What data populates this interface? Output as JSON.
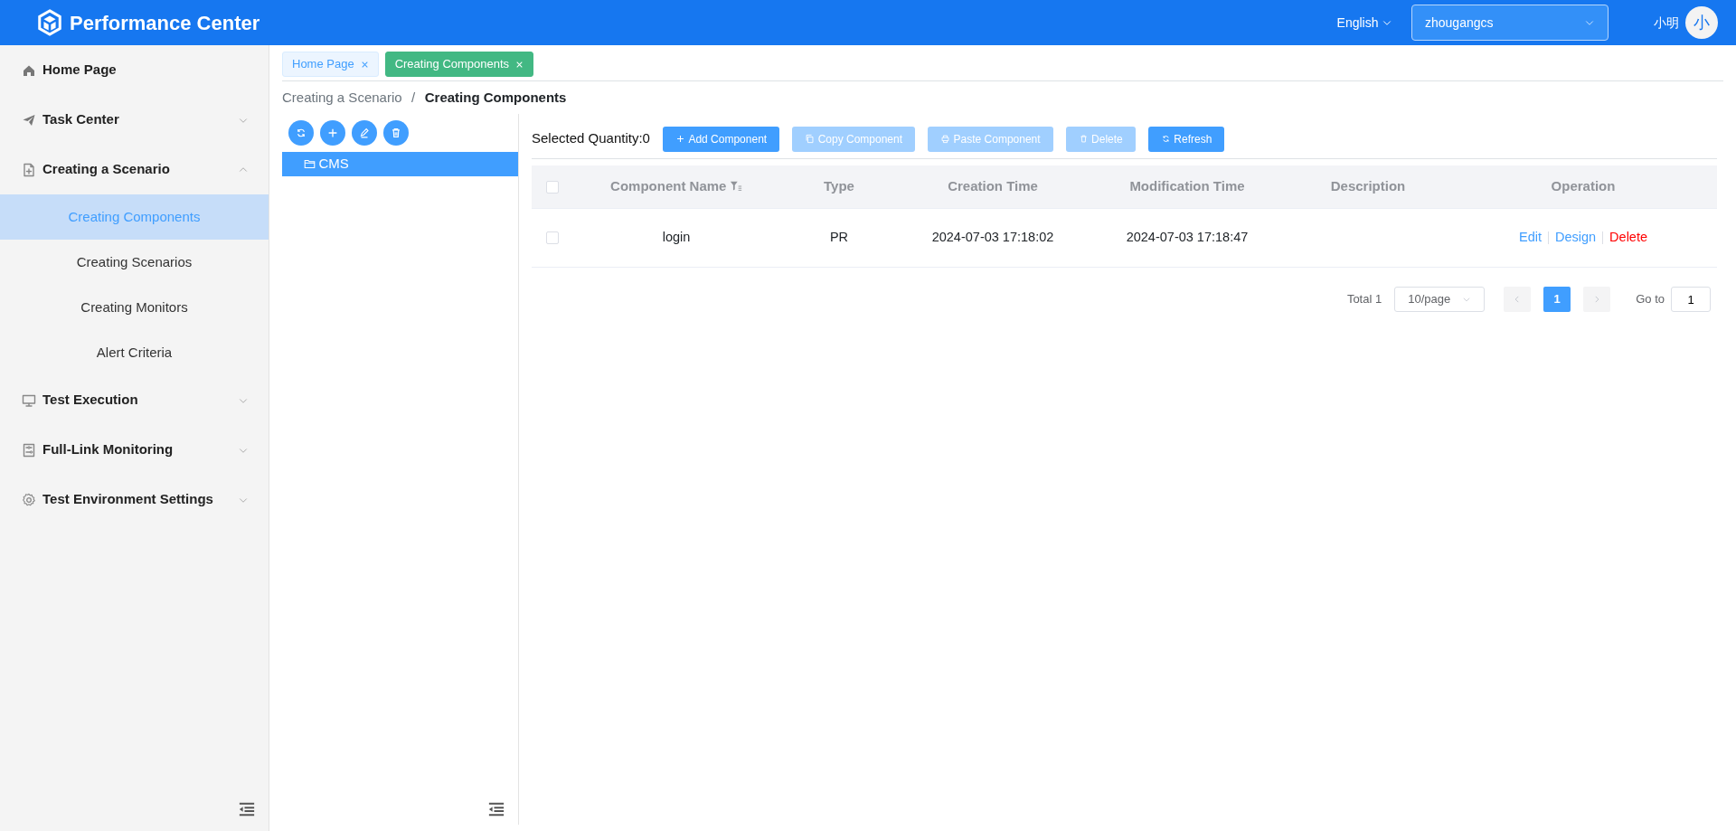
{
  "header": {
    "app_title": "Performance Center",
    "language": "English",
    "project_select": {
      "value": "zhougangcs"
    },
    "user_name": "小明",
    "avatar_text": "小"
  },
  "sidebar": {
    "items": [
      {
        "label": "Home Page"
      },
      {
        "label": "Task Center",
        "expanded": false
      },
      {
        "label": "Creating a Scenario",
        "expanded": true,
        "children": [
          {
            "label": "Creating Components",
            "selected": true
          },
          {
            "label": "Creating Scenarios",
            "selected": false
          },
          {
            "label": "Creating Monitors",
            "selected": false
          },
          {
            "label": "Alert Criteria",
            "selected": false
          }
        ]
      },
      {
        "label": "Test Execution",
        "expanded": false
      },
      {
        "label": "Full-Link Monitoring",
        "expanded": false
      },
      {
        "label": "Test Environment Settings",
        "expanded": false
      }
    ]
  },
  "tabs": [
    {
      "label": "Home Page",
      "selected": false
    },
    {
      "label": "Creating Components",
      "selected": true
    }
  ],
  "breadcrumb": {
    "separator": "/",
    "items": [
      {
        "label": "Creating a Scenario",
        "current": false
      },
      {
        "label": "Creating Components",
        "current": true
      }
    ]
  },
  "tree": {
    "items": [
      {
        "label": "CMS",
        "selected": true
      }
    ]
  },
  "toolbar": {
    "selected_quantity": "Selected Quantity:0",
    "buttons": [
      {
        "label": "Add Component",
        "disabled": false
      },
      {
        "label": "Copy Component",
        "disabled": true
      },
      {
        "label": "Paste Component",
        "disabled": true
      },
      {
        "label": "Delete",
        "disabled": true
      },
      {
        "label": "Refresh",
        "disabled": false
      }
    ]
  },
  "table": {
    "all_checked": false,
    "columns": [
      {
        "label": "Component Name",
        "filterable": true
      },
      {
        "label": "Type",
        "filterable": false
      },
      {
        "label": "Creation Time",
        "filterable": false
      },
      {
        "label": "Modification Time",
        "filterable": false
      },
      {
        "label": "Description",
        "filterable": false
      },
      {
        "label": "Operation",
        "filterable": false
      }
    ],
    "rows": [
      {
        "checked": false,
        "cells": [
          "login",
          "PR",
          "2024-07-03 17:18:02",
          "2024-07-03 17:18:47"
        ],
        "actions": [
          {
            "label": "Edit",
            "kind": "link"
          },
          {
            "label": "Design",
            "kind": "link"
          },
          {
            "label": "Delete",
            "kind": "danger"
          }
        ]
      }
    ]
  },
  "pagination": {
    "total": "Total 1",
    "page_size": "10/page",
    "prev_disabled": true,
    "next_disabled": true,
    "pages": [
      {
        "label": "1",
        "selected": true
      }
    ],
    "goto_label": "Go to",
    "goto_value": "1"
  }
}
